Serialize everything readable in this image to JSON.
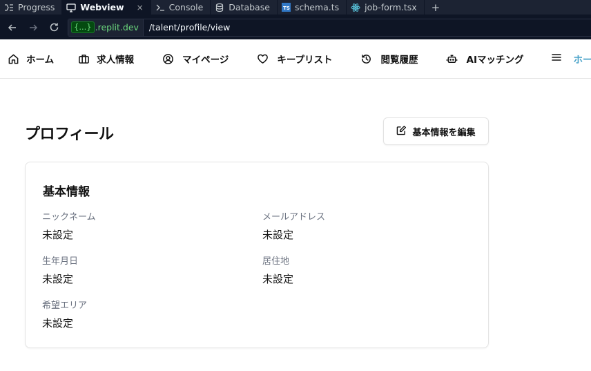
{
  "ide_tabs": [
    {
      "label": "Progress",
      "icon": "progress-icon",
      "active": false
    },
    {
      "label": "Webview",
      "icon": "monitor-icon",
      "active": true,
      "close": "×"
    },
    {
      "label": "Console",
      "icon": "terminal-icon",
      "active": false
    },
    {
      "label": "Database",
      "icon": "database-icon",
      "active": false
    },
    {
      "label": "schema.ts",
      "icon": "typescript-file-icon",
      "icon_text": "TS",
      "active": false
    },
    {
      "label": "job-form.tsx",
      "icon": "react-file-icon",
      "active": false
    }
  ],
  "add_tab": "+",
  "url_bar": {
    "domain_pill": "{...}",
    "domain_suffix": ".replit.dev",
    "path": "/talent/profile/view"
  },
  "nav": {
    "items": [
      {
        "label": "ホーム",
        "icon": "home-icon"
      },
      {
        "label": "求人情報",
        "icon": "briefcase-icon"
      },
      {
        "label": "マイページ",
        "icon": "user-circle-icon"
      },
      {
        "label": "キープリスト",
        "icon": "heart-icon"
      },
      {
        "label": "閲覧履歴",
        "icon": "history-icon"
      },
      {
        "label": "AIマッチング",
        "icon": "robot-icon"
      }
    ],
    "menu_icon": "hamburger-menu-icon",
    "active_label": "ホーム"
  },
  "page": {
    "title": "プロフィール",
    "edit_button": "基本情報を編集"
  },
  "card": {
    "title": "基本情報",
    "fields": [
      {
        "label": "ニックネーム",
        "value": "未設定"
      },
      {
        "label": "メールアドレス",
        "value": "未設定"
      },
      {
        "label": "生年月日",
        "value": "未設定"
      },
      {
        "label": "居住地",
        "value": "未設定"
      },
      {
        "label": "希望エリア",
        "value": "未設定"
      }
    ]
  },
  "colors": {
    "ide_bg": "#1c2333",
    "ide_active_bg": "#0e1525",
    "domain_green": "#6cd97e",
    "accent_active_nav": "#4aa3c9"
  }
}
